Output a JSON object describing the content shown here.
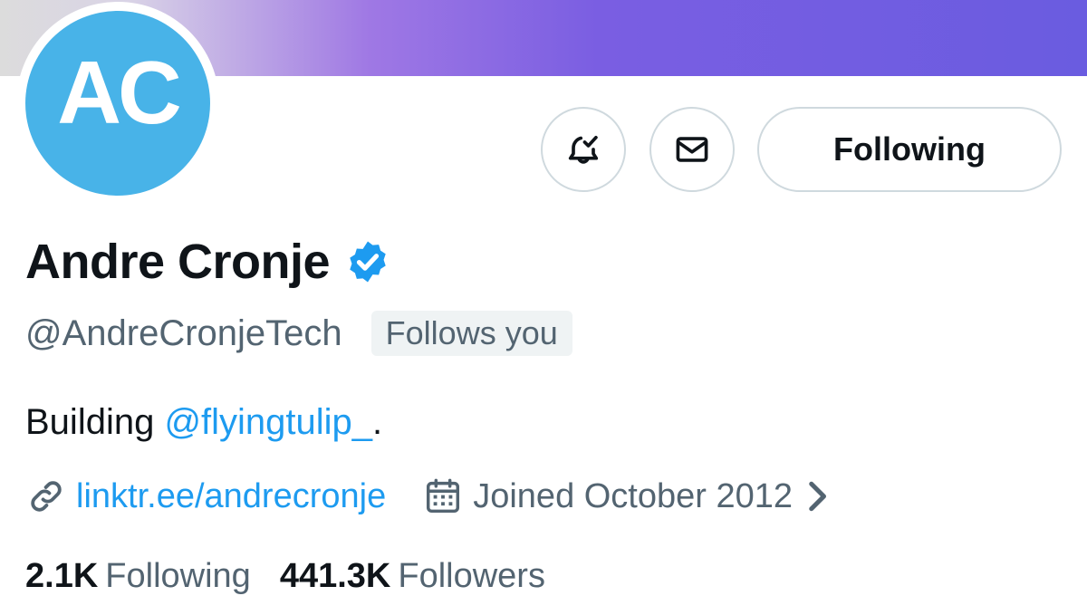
{
  "profile": {
    "avatar_initials": "AC",
    "display_name": "Andre Cronje",
    "handle": "@AndreCronjeTech",
    "follows_you": "Follows you",
    "bio_prefix": "Building ",
    "bio_mention": "@flyingtulip_",
    "bio_suffix": ".",
    "link": "linktr.ee/andrecronje",
    "joined": "Joined October 2012",
    "following_count": "2.1K",
    "following_label": "Following",
    "followers_count": "441.3K",
    "followers_label": "Followers"
  },
  "actions": {
    "follow_state_label": "Following"
  },
  "icons": {
    "notify": "bell-check-icon",
    "message": "envelope-icon",
    "verified": "verified-badge-icon",
    "link": "link-icon",
    "calendar": "calendar-icon",
    "chevron": "chevron-right-icon"
  },
  "colors": {
    "accent": "#1d9bf0",
    "avatar_bg": "#48b3e8",
    "banner_end": "#6a5ce0",
    "secondary_text": "#536471",
    "border": "#cfd9de"
  }
}
